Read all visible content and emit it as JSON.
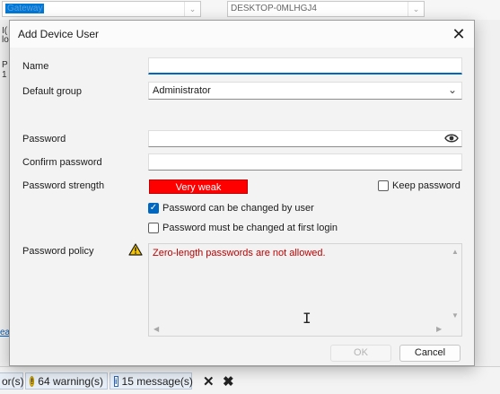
{
  "background": {
    "combo_left_value": "Gateway",
    "combo_right_value": "DESKTOP-0MLHGJ4",
    "left_fragments": [
      "I(",
      "lo",
      "P",
      "1"
    ],
    "link_fragment": "ea"
  },
  "status_bar": {
    "fragment": "or(s)",
    "warnings": "64 warning(s)",
    "messages": "15 message(s)"
  },
  "dialog": {
    "title": "Add Device User",
    "name": {
      "label": "Name",
      "value": ""
    },
    "default_group": {
      "label": "Default group",
      "value": "Administrator"
    },
    "password": {
      "label": "Password",
      "value": ""
    },
    "confirm_password": {
      "label": "Confirm password",
      "value": ""
    },
    "strength": {
      "label": "Password strength",
      "value": "Very weak",
      "color": "#ff0000"
    },
    "keep_password": {
      "label": "Keep password",
      "checked": false
    },
    "can_be_changed": {
      "label": "Password can be changed by user",
      "checked": true
    },
    "must_change": {
      "label": "Password must be changed at first login",
      "checked": false
    },
    "policy": {
      "label": "Password policy",
      "message": "Zero-length passwords are not allowed.",
      "message_color": "#c00000"
    },
    "buttons": {
      "ok": "OK",
      "cancel": "Cancel"
    }
  },
  "accent_color": "#0067c0"
}
